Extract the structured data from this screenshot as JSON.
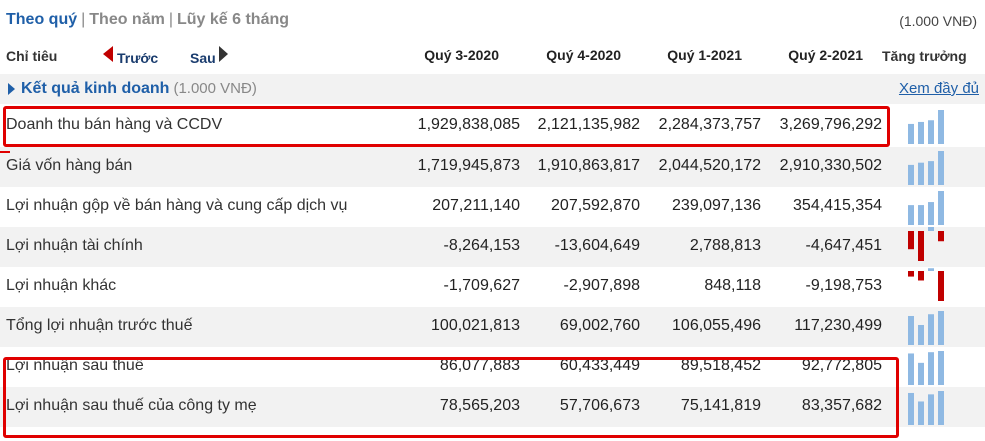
{
  "tabs": {
    "quarter": "Theo quý",
    "year": "Theo năm",
    "cumulative": "Lũy kế 6 tháng",
    "separator": "|"
  },
  "unit": "(1.000 VNĐ)",
  "header": {
    "label": "Chỉ tiêu",
    "prev": "Trước",
    "next": "Sau",
    "quarters": [
      "Quý 3-2020",
      "Quý 4-2020",
      "Quý 1-2021",
      "Quý 2-2021"
    ],
    "growth": "Tăng trưởng"
  },
  "section": {
    "title": "Kết quả kinh doanh",
    "unit": "(1.000 VNĐ)",
    "more": "Xem đầy đủ"
  },
  "rows": [
    {
      "name": "Doanh thu bán hàng và CCDV",
      "values": [
        "1,929,838,085",
        "2,121,135,982",
        "2,284,373,757",
        "3,269,796,292"
      ],
      "nums": [
        1929838085,
        2121135982,
        2284373757,
        3269796292
      ]
    },
    {
      "name": "Giá vốn hàng bán",
      "values": [
        "1,719,945,873",
        "1,910,863,817",
        "2,044,520,172",
        "2,910,330,502"
      ],
      "nums": [
        1719945873,
        1910863817,
        2044520172,
        2910330502
      ]
    },
    {
      "name": "Lợi nhuận gộp về bán hàng và cung cấp dịch vụ",
      "values": [
        "207,211,140",
        "207,592,870",
        "239,097,136",
        "354,415,354"
      ],
      "nums": [
        207211140,
        207592870,
        239097136,
        354415354
      ]
    },
    {
      "name": "Lợi nhuận tài chính",
      "values": [
        "-8,264,153",
        "-13,604,649",
        "2,788,813",
        "-4,647,451"
      ],
      "nums": [
        -8264153,
        -13604649,
        2788813,
        -4647451
      ]
    },
    {
      "name": "Lợi nhuận khác",
      "values": [
        "-1,709,627",
        "-2,907,898",
        "848,118",
        "-9,198,753"
      ],
      "nums": [
        -1709627,
        -2907898,
        848118,
        -9198753
      ]
    },
    {
      "name": "Tổng lợi nhuận trước thuế",
      "values": [
        "100,021,813",
        "69,002,760",
        "106,055,496",
        "117,230,499"
      ],
      "nums": [
        100021813,
        69002760,
        106055496,
        117230499
      ]
    },
    {
      "name": "Lợi nhuận sau thuế",
      "values": [
        "86,077,883",
        "60,433,449",
        "89,518,452",
        "92,772,805"
      ],
      "nums": [
        86077883,
        60433449,
        89518452,
        92772805
      ]
    },
    {
      "name": "Lợi nhuận sau thuế của công ty mẹ",
      "values": [
        "78,565,203",
        "57,706,673",
        "75,141,819",
        "83,357,682"
      ],
      "nums": [
        78565203,
        57706673,
        75141819,
        83357682
      ]
    }
  ],
  "colors": {
    "positive": "#8fb9e3",
    "negative": "#c00000",
    "highlight": "#e00000",
    "accent": "#1f5fa8"
  }
}
